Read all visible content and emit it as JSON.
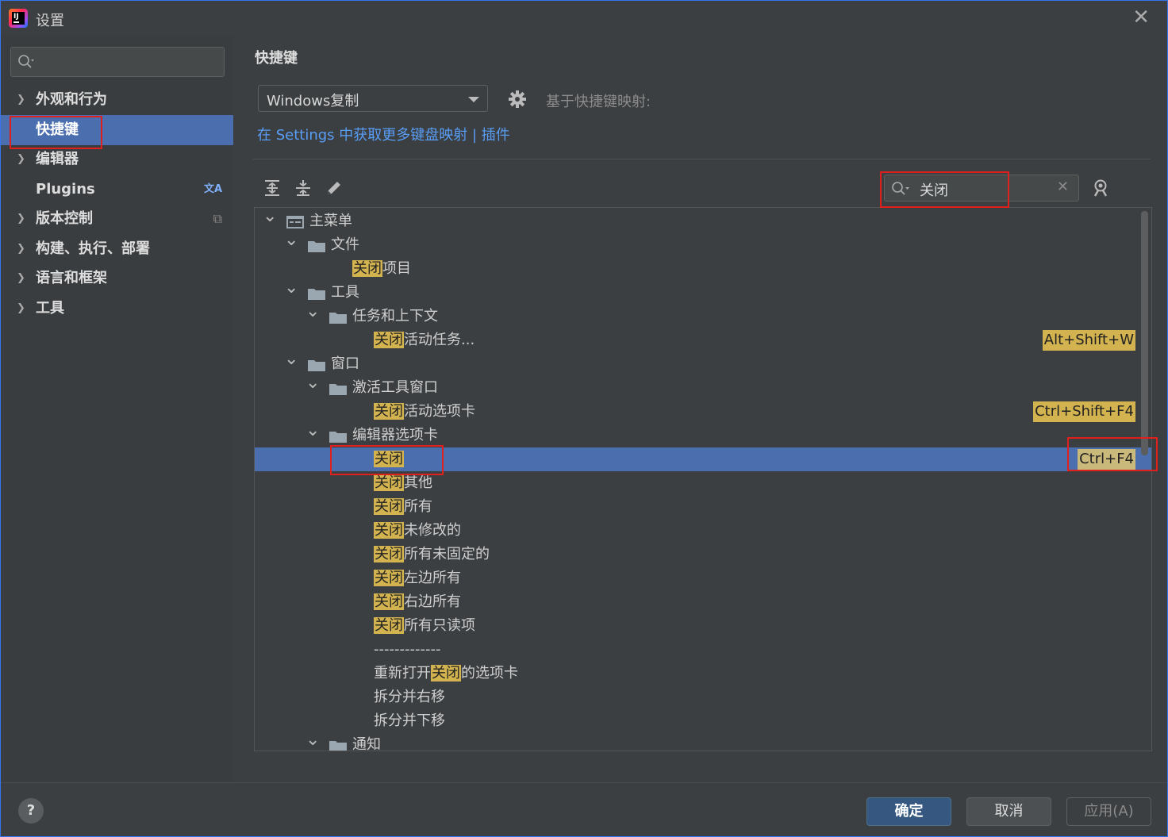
{
  "window": {
    "title": "设置"
  },
  "sidebar": {
    "search_placeholder": "",
    "items": [
      {
        "label": "外观和行为",
        "expandable": true
      },
      {
        "label": "快捷键",
        "expandable": false,
        "selected": true
      },
      {
        "label": "编辑器",
        "expandable": true
      },
      {
        "label": "Plugins",
        "expandable": false,
        "extra_icon": "translate-icon"
      },
      {
        "label": "版本控制",
        "expandable": true,
        "extra_icon": "copy-icon"
      },
      {
        "label": "构建、执行、部署",
        "expandable": true
      },
      {
        "label": "语言和框架",
        "expandable": true
      },
      {
        "label": "工具",
        "expandable": true
      }
    ]
  },
  "main": {
    "title": "快捷键",
    "keymap_value": "Windows复制",
    "based_on_label": "基于快捷键映射:",
    "link_text": "在 Settings 中获取更多键盘映射 | 插件",
    "search_value": "关闭",
    "highlight_color": "#d2b34f",
    "selection_color": "#4b6eaf"
  },
  "tree": {
    "rows": [
      {
        "pre": "",
        "hl": "",
        "post": "主菜单",
        "shortcut": "",
        "type": "menu-root"
      },
      {
        "pre": "",
        "hl": "",
        "post": "文件",
        "shortcut": "",
        "type": "folder"
      },
      {
        "pre": "",
        "hl": "关闭",
        "post": "项目",
        "shortcut": "",
        "type": "action"
      },
      {
        "pre": "",
        "hl": "",
        "post": "工具",
        "shortcut": "",
        "type": "folder"
      },
      {
        "pre": "",
        "hl": "",
        "post": "任务和上下文",
        "shortcut": "",
        "type": "folder"
      },
      {
        "pre": "",
        "hl": "关闭",
        "post": "活动任务...",
        "shortcut": "Alt+Shift+W",
        "type": "action"
      },
      {
        "pre": "",
        "hl": "",
        "post": "窗口",
        "shortcut": "",
        "type": "folder"
      },
      {
        "pre": "",
        "hl": "",
        "post": "激活工具窗口",
        "shortcut": "",
        "type": "folder"
      },
      {
        "pre": "",
        "hl": "关闭",
        "post": "活动选项卡",
        "shortcut": "Ctrl+Shift+F4",
        "type": "action"
      },
      {
        "pre": "",
        "hl": "",
        "post": "编辑器选项卡",
        "shortcut": "",
        "type": "folder"
      },
      {
        "pre": "",
        "hl": "关闭",
        "post": "",
        "shortcut": "Ctrl+F4",
        "type": "action",
        "selected": true
      },
      {
        "pre": "",
        "hl": "关闭",
        "post": "其他",
        "shortcut": "",
        "type": "action"
      },
      {
        "pre": "",
        "hl": "关闭",
        "post": "所有",
        "shortcut": "",
        "type": "action"
      },
      {
        "pre": "",
        "hl": "关闭",
        "post": "未修改的",
        "shortcut": "",
        "type": "action"
      },
      {
        "pre": "",
        "hl": "关闭",
        "post": "所有未固定的",
        "shortcut": "",
        "type": "action"
      },
      {
        "pre": "",
        "hl": "关闭",
        "post": "左边所有",
        "shortcut": "",
        "type": "action"
      },
      {
        "pre": "",
        "hl": "关闭",
        "post": "右边所有",
        "shortcut": "",
        "type": "action"
      },
      {
        "pre": "",
        "hl": "关闭",
        "post": "所有只读项",
        "shortcut": "",
        "type": "action"
      },
      {
        "pre": "",
        "hl": "",
        "post": "-------------",
        "shortcut": "",
        "type": "separator"
      },
      {
        "pre": "重新打开",
        "hl": "关闭",
        "post": "的选项卡",
        "shortcut": "",
        "type": "action"
      },
      {
        "pre": "",
        "hl": "",
        "post": "拆分并右移",
        "shortcut": "",
        "type": "action"
      },
      {
        "pre": "",
        "hl": "",
        "post": "拆分并下移",
        "shortcut": "",
        "type": "action"
      },
      {
        "pre": "",
        "hl": "",
        "post": "通知",
        "shortcut": "",
        "type": "folder"
      }
    ]
  },
  "footer": {
    "help_label": "?",
    "ok_label": "确定",
    "cancel_label": "取消",
    "apply_label": "应用(A)"
  }
}
